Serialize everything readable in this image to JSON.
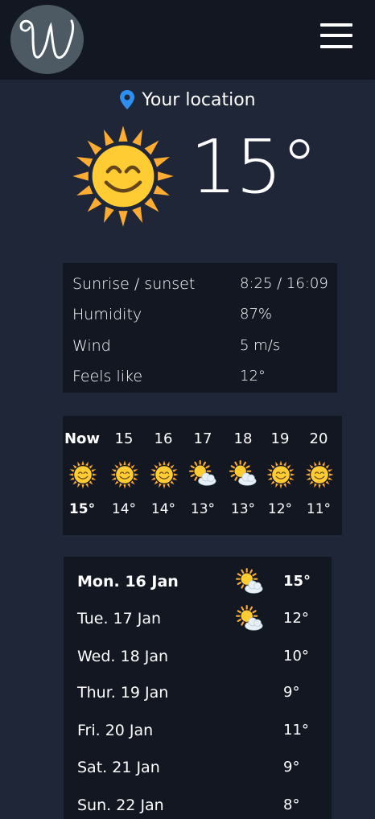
{
  "header": {
    "logo_icon": "script-w-logo-icon",
    "menu_icon": "hamburger-menu-icon"
  },
  "location": {
    "label": "Your location",
    "icon": "map-pin-icon",
    "pin_color": "#2d8ff0"
  },
  "current": {
    "temperature": "15°",
    "icon": "smiling-sun-icon"
  },
  "details": [
    {
      "label": "Sunrise / sunset",
      "value": "8:25 / 16:09"
    },
    {
      "label": "Humidity",
      "value": "87%"
    },
    {
      "label": "Wind",
      "value": "5 m/s"
    },
    {
      "label": "Feels like",
      "value": "12°"
    }
  ],
  "hourly": [
    {
      "hour": "Now",
      "icon": "smiling-sun-icon",
      "temp": "15°"
    },
    {
      "hour": "15",
      "icon": "smiling-sun-icon",
      "temp": "14°"
    },
    {
      "hour": "16",
      "icon": "smiling-sun-icon",
      "temp": "14°"
    },
    {
      "hour": "17",
      "icon": "sun-behind-cloud-icon",
      "temp": "13°"
    },
    {
      "hour": "18",
      "icon": "sun-behind-cloud-icon",
      "temp": "13°"
    },
    {
      "hour": "19",
      "icon": "smiling-sun-icon",
      "temp": "12°"
    },
    {
      "hour": "20",
      "icon": "smiling-sun-icon",
      "temp": "11°"
    }
  ],
  "daily": [
    {
      "day": "Mon. 16 Jan",
      "icon": "sun-behind-cloud-icon",
      "temp": "15°"
    },
    {
      "day": "Tue. 17 Jan",
      "icon": "sun-behind-cloud-icon",
      "temp": "12°"
    },
    {
      "day": "Wed. 18 Jan",
      "icon": "",
      "temp": "10°"
    },
    {
      "day": "Thur. 19 Jan",
      "icon": "",
      "temp": "9°"
    },
    {
      "day": "Fri. 20 Jan",
      "icon": "",
      "temp": "11°"
    },
    {
      "day": "Sat. 21 Jan",
      "icon": "",
      "temp": "9°"
    },
    {
      "day": "Sun. 22 Jan",
      "icon": "",
      "temp": "8°"
    }
  ],
  "colors": {
    "background": "#1e2638",
    "panel": "#121722",
    "sun": "#ffcc33",
    "sun_rays": "#ffac33"
  }
}
